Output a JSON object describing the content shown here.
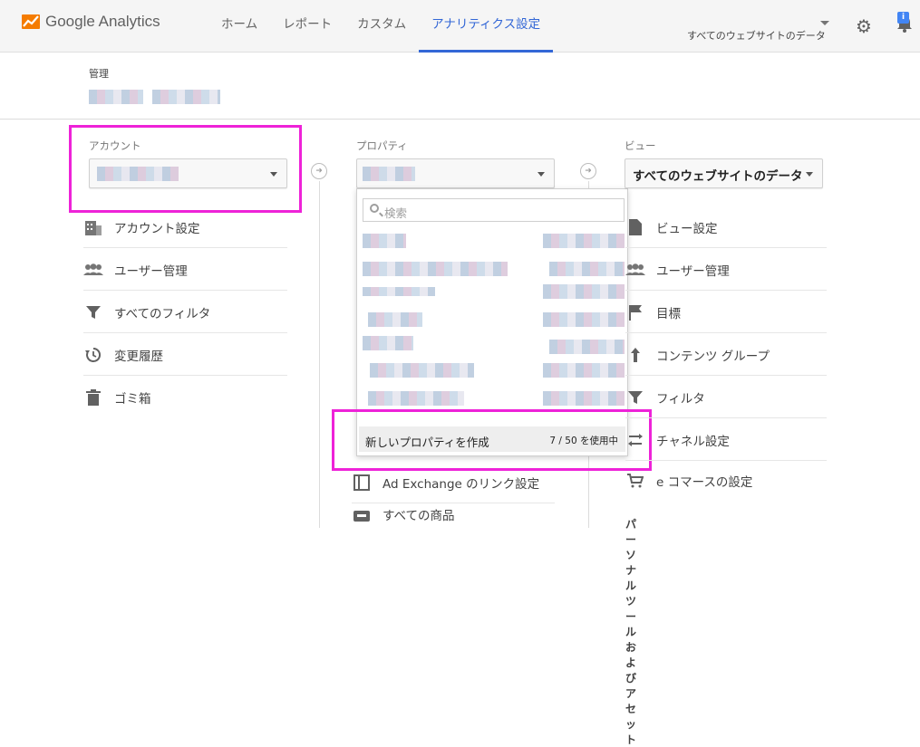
{
  "app": {
    "name": "Google Analytics",
    "accent_color": "#3367d6",
    "logo_color": "#f57c00"
  },
  "nav": {
    "items": [
      {
        "label": "ホーム",
        "active": false
      },
      {
        "label": "レポート",
        "active": false
      },
      {
        "label": "カスタム",
        "active": false
      },
      {
        "label": "アナリティクス設定",
        "active": true
      }
    ]
  },
  "header": {
    "scope_label": "すべてのウェブサイトのデータ",
    "settings_icon": "gear-icon",
    "notifications_icon": "bell-icon",
    "notifications_badge": "i"
  },
  "admin": {
    "label": "管理"
  },
  "account": {
    "label": "アカウント",
    "menu": [
      {
        "label": "アカウント設定",
        "icon": "building-icon"
      },
      {
        "label": "ユーザー管理",
        "icon": "people-icon"
      },
      {
        "label": "すべてのフィルタ",
        "icon": "filter-icon"
      },
      {
        "label": "変更履歴",
        "icon": "history-icon"
      },
      {
        "label": "ゴミ箱",
        "icon": "trash-icon"
      }
    ]
  },
  "property": {
    "label": "プロパティ",
    "dropdown": {
      "search_placeholder": "検索",
      "create_label": "新しいプロパティを作成",
      "create_count": "7 / 50 を使用中"
    },
    "menu": [
      {
        "label": "Ad Exchange のリンク設定",
        "icon": "square-icon"
      },
      {
        "label": "すべての商品",
        "icon": "link-icon"
      }
    ]
  },
  "view": {
    "label": "ビュー",
    "selected": "すべてのウェブサイトのデータ",
    "menu": [
      {
        "label": "ビュー設定",
        "icon": "document-icon"
      },
      {
        "label": "ユーザー管理",
        "icon": "people-icon"
      },
      {
        "label": "目標",
        "icon": "flag-icon"
      },
      {
        "label": "コンテンツ グループ",
        "icon": "tool-icon"
      },
      {
        "label": "フィルタ",
        "icon": "filter-icon"
      },
      {
        "label": "チャネル設定",
        "icon": "channel-icon"
      },
      {
        "label": "e コマースの設定",
        "icon": "cart-icon"
      }
    ],
    "section_heading": "パーソナルツールおよびアセット"
  },
  "highlight_color": "#ee22d8"
}
